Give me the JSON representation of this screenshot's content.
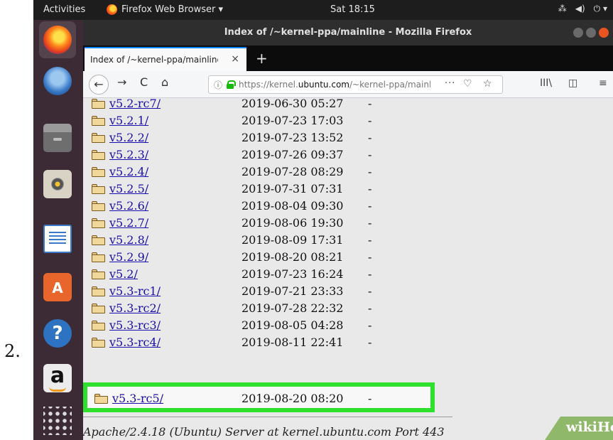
{
  "step_number": "2.",
  "topbar": {
    "activities": "Activities",
    "app_menu": "Firefox Web Browser ▾",
    "clock": "Sat 18:15",
    "status_icons": [
      "network-icon",
      "volume-icon",
      "power-icon"
    ]
  },
  "dock": {
    "items": [
      "firefox-icon",
      "thunderbird-icon",
      "files-icon",
      "rhythmbox-icon",
      "writer-icon",
      "software-icon",
      "help-icon",
      "amazon-icon",
      "show-apps-icon"
    ],
    "help_glyph": "?",
    "store_glyph": "A",
    "amazon_glyph": "a"
  },
  "window": {
    "title": "Index of /~kernel-ppa/mainline - Mozilla Firefox"
  },
  "tab": {
    "label": "Index of /~kernel-ppa/mainline",
    "close": "×",
    "new_tab": "+"
  },
  "navbar": {
    "back": "←",
    "forward": "→",
    "reload": "C",
    "home": "⌂",
    "url_prefix": "https://kernel.",
    "url_domain": "ubuntu.com",
    "url_suffix": "/~kernel-ppa/mainline/",
    "info": "ⓘ",
    "more": "···",
    "pocket": "♡",
    "star": "☆",
    "library": "III\\",
    "sidebar": "◫",
    "menu": "≡"
  },
  "listing": [
    {
      "name": "v5.2-rc7/",
      "date": "2019-06-30 05:27",
      "size": "-"
    },
    {
      "name": "v5.2.1/",
      "date": "2019-07-23 17:03",
      "size": "-"
    },
    {
      "name": "v5.2.2/",
      "date": "2019-07-23 13:52",
      "size": "-"
    },
    {
      "name": "v5.2.3/",
      "date": "2019-07-26 09:37",
      "size": "-"
    },
    {
      "name": "v5.2.4/",
      "date": "2019-07-28 08:29",
      "size": "-"
    },
    {
      "name": "v5.2.5/",
      "date": "2019-07-31 07:31",
      "size": "-"
    },
    {
      "name": "v5.2.6/",
      "date": "2019-08-04 09:30",
      "size": "-"
    },
    {
      "name": "v5.2.7/",
      "date": "2019-08-06 19:30",
      "size": "-"
    },
    {
      "name": "v5.2.8/",
      "date": "2019-08-09 17:31",
      "size": "-"
    },
    {
      "name": "v5.2.9/",
      "date": "2019-08-20 08:21",
      "size": "-"
    },
    {
      "name": "v5.2/",
      "date": "2019-07-23 16:24",
      "size": "-"
    },
    {
      "name": "v5.3-rc1/",
      "date": "2019-07-21 23:33",
      "size": "-"
    },
    {
      "name": "v5.3-rc2/",
      "date": "2019-07-28 22:32",
      "size": "-"
    },
    {
      "name": "v5.3-rc3/",
      "date": "2019-08-05 04:28",
      "size": "-"
    },
    {
      "name": "v5.3-rc4/",
      "date": "2019-08-11 22:41",
      "size": "-"
    }
  ],
  "highlighted": {
    "name": "v5.3-rc5/",
    "date": "2019-08-20 08:20",
    "size": "-"
  },
  "footer": "Apache/2.4.18 (Ubuntu) Server at kernel.ubuntu.com Port 443",
  "watermark": "wikiHow",
  "colors": {
    "highlight": "#2fe02f",
    "link": "#1a0dab",
    "ubuntu_orange": "#e95420",
    "dock": "#3c2a35"
  }
}
